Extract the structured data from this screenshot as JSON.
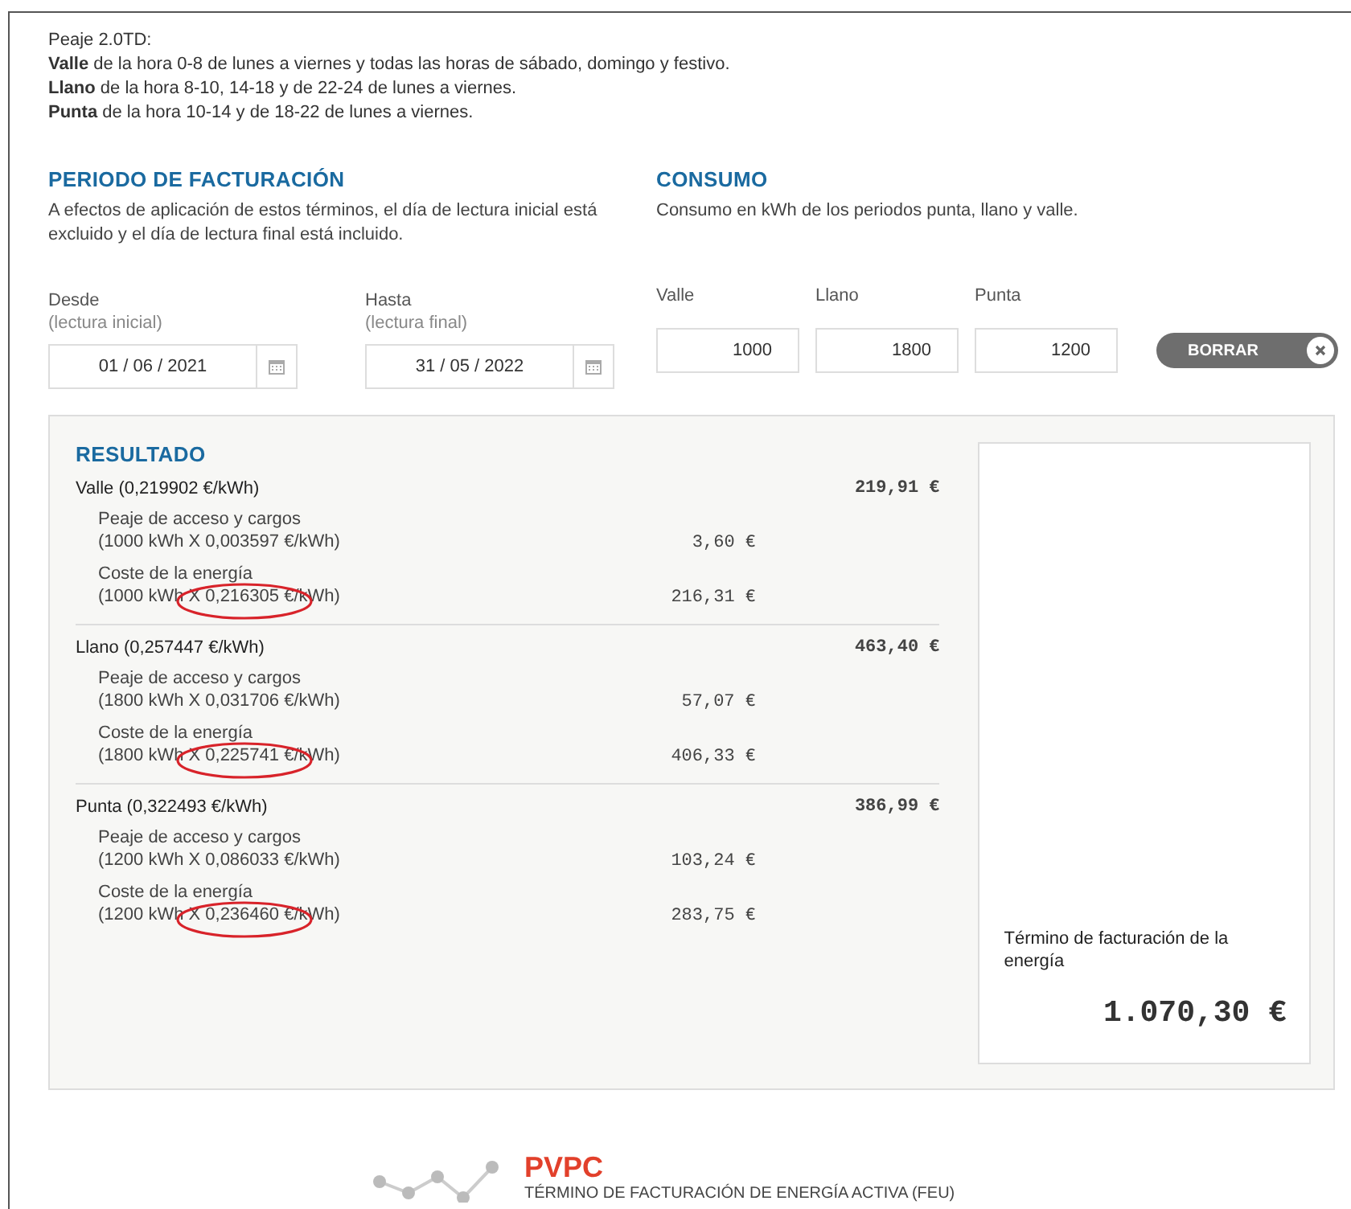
{
  "intro": {
    "title": "Peaje 2.0TD:",
    "lines": [
      "**Valle** de la hora 0-8 de lunes a viernes y todas las horas de sábado, domingo y festivo.",
      "**Llano** de la hora 8-10, 14-18 y de 22-24 de lunes a viernes.",
      "**Punta** de la hora 10-14 y de 18-22 de lunes a viernes."
    ]
  },
  "periodo": {
    "title": "PERIODO DE FACTURACIÓN",
    "text": "A efectos de aplicación de estos términos, el día de lectura inicial está excluido y el día de lectura final está incluido.",
    "fields": [
      {
        "label": "Desde",
        "sublabel": "(lectura inicial)",
        "value": "01 / 06 / 2021"
      },
      {
        "label": "Hasta",
        "sublabel": "(lectura final)",
        "value": "31 / 05 / 2022"
      }
    ]
  },
  "consumo": {
    "title": "CONSUMO",
    "text": "Consumo en kWh de los periodos punta, llano y valle.",
    "fields": [
      {
        "label": "Valle",
        "value": "1000"
      },
      {
        "label": "Llano",
        "value": "1800"
      },
      {
        "label": "Punta",
        "value": "1200"
      }
    ],
    "clear_button": "BORRAR"
  },
  "resultado": {
    "title": "RESULTADO",
    "periods": [
      {
        "name": "Valle (0,219902 €/kWh)",
        "total": "219,91 €",
        "lines": [
          {
            "label": "Peaje de acceso y cargos",
            "detail": "(1000 kWh X 0,003597 €/kWh)",
            "amount": "3,60 €",
            "circled": false
          },
          {
            "label": "Coste de la energía",
            "detail": "(1000 kWh X 0,216305 €/kWh)",
            "amount": "216,31 €",
            "circled": true
          }
        ]
      },
      {
        "name": "Llano (0,257447 €/kWh)",
        "total": "463,40 €",
        "lines": [
          {
            "label": "Peaje de acceso y cargos",
            "detail": "(1800 kWh X 0,031706 €/kWh)",
            "amount": "57,07 €",
            "circled": false
          },
          {
            "label": "Coste de la energía",
            "detail": "(1800 kWh X 0,225741 €/kWh)",
            "amount": "406,33 €",
            "circled": true
          }
        ]
      },
      {
        "name": "Punta (0,322493 €/kWh)",
        "total": "386,99 €",
        "lines": [
          {
            "label": "Peaje de acceso y cargos",
            "detail": "(1200 kWh X 0,086033 €/kWh)",
            "amount": "103,24 €",
            "circled": false
          },
          {
            "label": "Coste de la energía",
            "detail": "(1200 kWh X 0,236460 €/kWh)",
            "amount": "283,75 €",
            "circled": true
          }
        ]
      }
    ],
    "summary": {
      "label": "Término de facturación de la energía",
      "value": "1.070,30 €"
    }
  },
  "footer": {
    "title": "PVPC",
    "subtitle": "TÉRMINO DE FACTURACIÓN DE ENERGÍA ACTIVA (FEU)"
  }
}
